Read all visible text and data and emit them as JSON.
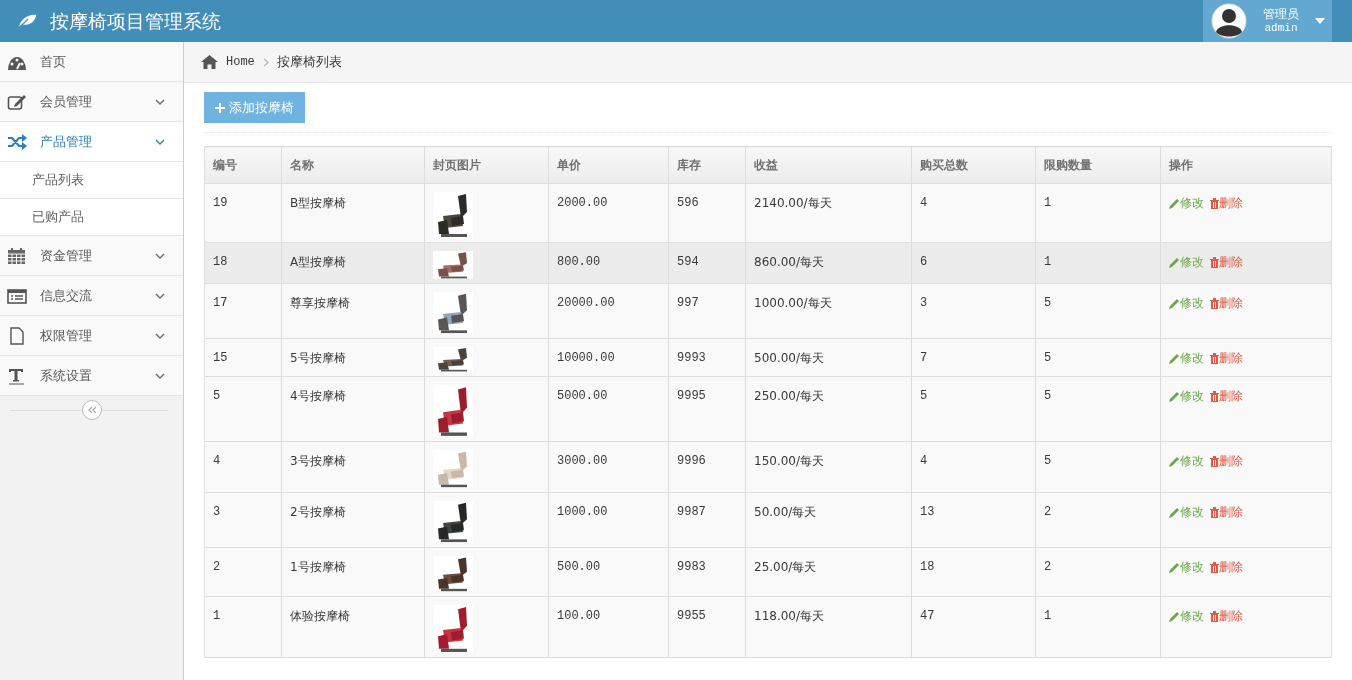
{
  "header": {
    "title": "按摩椅项目管理系统",
    "user": {
      "role": "管理员",
      "name": "admin"
    }
  },
  "sidebar": {
    "items": [
      {
        "label": "首页",
        "kind": "link",
        "selected": false
      },
      {
        "label": "会员管理",
        "kind": "menu",
        "selected": false
      },
      {
        "label": "产品管理",
        "kind": "menu",
        "selected": true,
        "children": [
          {
            "label": "产品列表"
          },
          {
            "label": "已购产品"
          }
        ]
      },
      {
        "label": "资金管理",
        "kind": "menu",
        "selected": false
      },
      {
        "label": "信息交流",
        "kind": "menu",
        "selected": false
      },
      {
        "label": "权限管理",
        "kind": "menu",
        "selected": false
      },
      {
        "label": "系统设置",
        "kind": "menu",
        "selected": false
      }
    ]
  },
  "breadcrumb": [
    "Home",
    "按摩椅列表"
  ],
  "add_button": "添加按摩椅",
  "table": {
    "columns": [
      "编号",
      "名称",
      "封页图片",
      "单价",
      "库存",
      "收益",
      "购买总数",
      "限购数量",
      "操作"
    ],
    "rows": [
      {
        "id": "19",
        "name": "B型按摩椅",
        "price": "2000.00",
        "stock": "596",
        "income": "2140.00/每天",
        "total": "4",
        "limit": "1",
        "edit": "修改",
        "delete": "删除",
        "selected": false
      },
      {
        "id": "18",
        "name": "A型按摩椅",
        "price": "800.00",
        "stock": "594",
        "income": "860.00/每天",
        "total": "6",
        "limit": "1",
        "edit": "修改",
        "delete": "删除",
        "selected": true
      },
      {
        "id": "17",
        "name": "尊享按摩椅",
        "price": "20000.00",
        "stock": "997",
        "income": "1000.00/每天",
        "total": "3",
        "limit": "5",
        "edit": "修改",
        "delete": "删除",
        "selected": false
      },
      {
        "id": "15",
        "name": "5号按摩椅",
        "price": "10000.00",
        "stock": "9993",
        "income": "500.00/每天",
        "total": "7",
        "limit": "5",
        "edit": "修改",
        "delete": "删除",
        "selected": false
      },
      {
        "id": "5",
        "name": "4号按摩椅",
        "price": "5000.00",
        "stock": "9995",
        "income": "250.00/每天",
        "total": "5",
        "limit": "5",
        "edit": "修改",
        "delete": "删除",
        "selected": false
      },
      {
        "id": "4",
        "name": "3号按摩椅",
        "price": "3000.00",
        "stock": "9996",
        "income": "150.00/每天",
        "total": "4",
        "limit": "5",
        "edit": "修改",
        "delete": "删除",
        "selected": false
      },
      {
        "id": "3",
        "name": "2号按摩椅",
        "price": "1000.00",
        "stock": "9987",
        "income": "50.00/每天",
        "total": "13",
        "limit": "2",
        "edit": "修改",
        "delete": "删除",
        "selected": false
      },
      {
        "id": "2",
        "name": "1号按摩椅",
        "price": "500.00",
        "stock": "9983",
        "income": "25.00/每天",
        "total": "18",
        "limit": "2",
        "edit": "修改",
        "delete": "删除",
        "selected": false
      },
      {
        "id": "1",
        "name": "体验按摩椅",
        "price": "100.00",
        "stock": "9955",
        "income": "118.00/每天",
        "total": "47",
        "limit": "1",
        "edit": "修改",
        "delete": "删除",
        "selected": false
      }
    ]
  }
}
